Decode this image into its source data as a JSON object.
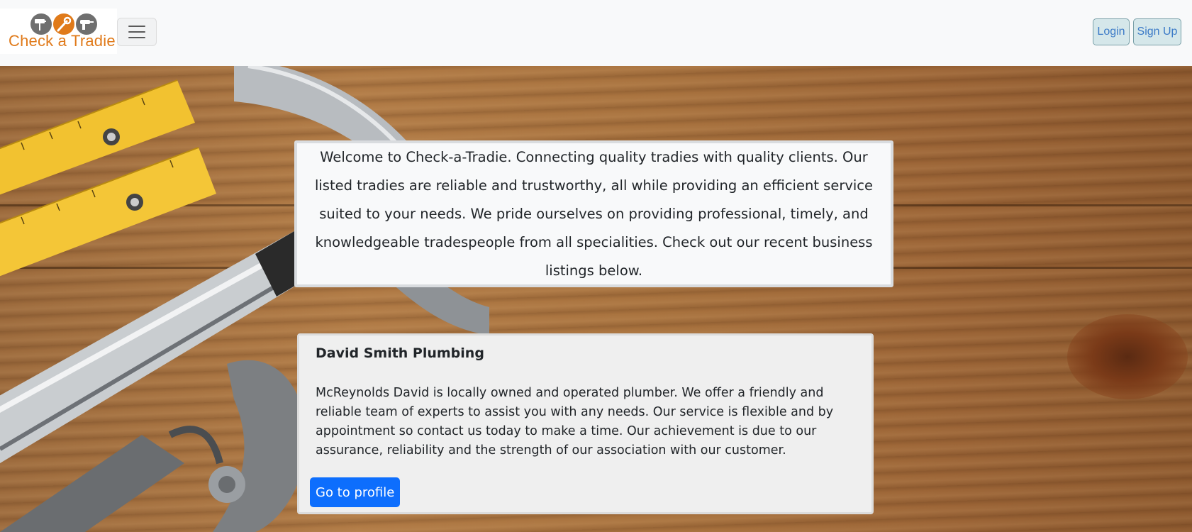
{
  "navbar": {
    "brand_name": "Check a Tradie",
    "logo_icons": [
      "paint-roller-icon",
      "wrench-icon",
      "drill-icon"
    ],
    "menu_icon": "hamburger-icon",
    "login_label": "Login",
    "signup_label": "Sign Up"
  },
  "welcome": {
    "text": "Welcome to Check-a-Tradie. Connecting quality tradies with quality clients. Our listed tradies are reliable and trustworthy, all while providing an efficient service suited to your needs. We pride ourselves on providing professional, timely, and knowledgeable tradespeople from all specialities. Check out our recent business listings below."
  },
  "listings": [
    {
      "title": "David Smith Plumbing",
      "description": "McReynolds David is locally owned and operated plumber. We offer a friendly and reliable team of experts to assist you with any needs. Our service is flexible and by appointment so contact us today to make a time. Our achievement is due to our assurance, reliability and the strength of our association with our customer.",
      "button_label": "Go to profile"
    }
  ],
  "colors": {
    "brand_orange": "#e07a1a",
    "primary_button": "#0d6efd",
    "navbar_bg": "#f8f9fa",
    "card_bg": "#f8f9fa"
  }
}
